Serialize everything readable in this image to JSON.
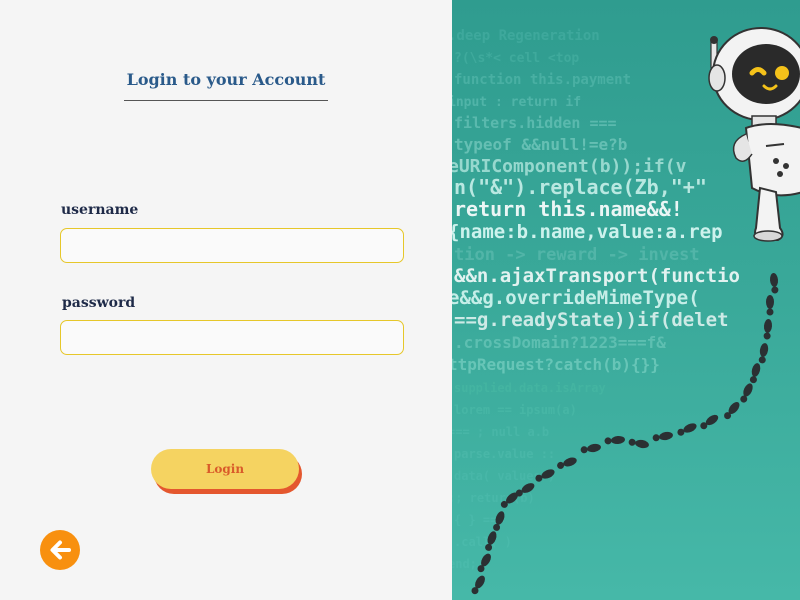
{
  "login_form": {
    "title": "Login to your Account",
    "username_label": "username",
    "username_value": "",
    "password_label": "password",
    "password_value": "",
    "login_button_label": "Login"
  },
  "navigation": {
    "back_icon": "arrow-left-icon"
  },
  "decoration": {
    "illustration": "robot-mascot",
    "footprints_icon": "footprints-icon",
    "code_lines": [
      "    .deep Regeneration",
      "?(\\s*<  cell <top",
      "function this.payment",
      "input : return  if",
      "filters.hidden  ===",
      "typeof  &&null!=e?b",
      "eURIComponent(b));if(v",
      "n(\"&\").replace(Zb,\"+\"",
      " return this.name&&!",
      "{name:b.name,value:a.rep",
      "tion -> reward -> invest",
      "&&n.ajaxTransport(functio",
      "e&&g.overrideMimeType(",
      "==g.readyState))if(delet",
      ".crossDomain?1223===f&",
      "ttpRequest?catch(b){}}",
      "  supplied.data.isArray",
      "  lorem  ==  ipsum(a)",
      "  ===  ;  null  a.b",
      "  parse.value  ::",
      "  data( values )",
      "  ;;  return(b)",
      "  {  }  ===",
      "  .call(  )",
      "  end;"
    ],
    "colors": {
      "panel_background": "#3aa99a",
      "footprints": "#2b3033",
      "robot_face": "#2a2a2a",
      "robot_eyes": "#f4c21a"
    }
  },
  "colors": {
    "title": "#2a5a8a",
    "label": "#1e2a48",
    "input_border": "#e6c72a",
    "button_fill": "#f5d361",
    "button_text": "#d95b2a",
    "button_shadow": "#e4572e",
    "back_button": "#f8900f"
  }
}
